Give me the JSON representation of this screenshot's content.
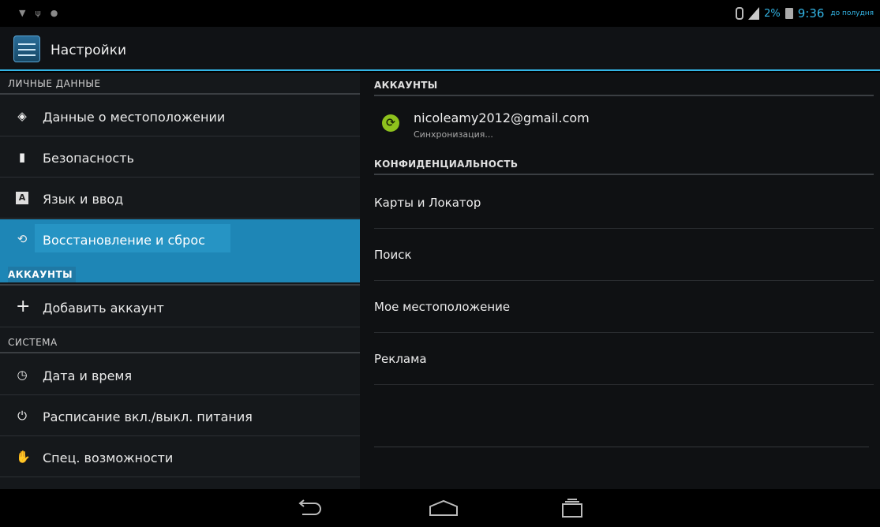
{
  "status_bar": {
    "battery_percent": "2%",
    "time": "9:36",
    "ampm": "до полудня"
  },
  "action_bar": {
    "title": "Настройки",
    "icon": "settings-sliders-icon"
  },
  "left_pane": {
    "section_personal": "ЛИЧНЫЕ ДАННЫЕ",
    "items_personal": [
      {
        "label": "Данные о местоположении",
        "icon": "location-icon"
      },
      {
        "label": "Безопасность",
        "icon": "lock-icon"
      },
      {
        "label": "Язык и ввод",
        "icon": "keyboard-icon"
      },
      {
        "label": "Восстановление и сброс",
        "icon": "backup-restore-icon",
        "selected": true
      }
    ],
    "section_accounts": "АККАУНТЫ",
    "add_account": {
      "label": "Добавить аккаунт",
      "icon": "plus-icon"
    },
    "section_system": "СИСТЕМА",
    "items_system": [
      {
        "label": "Дата и время",
        "icon": "clock-icon"
      },
      {
        "label": "Расписание вкл./выкл. питания",
        "icon": "power-schedule-icon"
      },
      {
        "label": "Спец. возможности",
        "icon": "hand-icon"
      }
    ]
  },
  "right_pane": {
    "section_accounts": "АККАУНТЫ",
    "account": {
      "email": "nicoleamy2012@gmail.com",
      "status": "Синхронизация...",
      "icon": "sync-icon"
    },
    "section_privacy": "КОНФИДЕНЦИАЛЬНОСТЬ",
    "items": [
      {
        "label": "Карты и Локатор"
      },
      {
        "label": "Поиск"
      },
      {
        "label": "Мое местоположение"
      },
      {
        "label": "Реклама"
      }
    ]
  },
  "colors": {
    "accent": "#33b5e5",
    "selected": "#1e86b6",
    "sync": "#8ec21d"
  }
}
